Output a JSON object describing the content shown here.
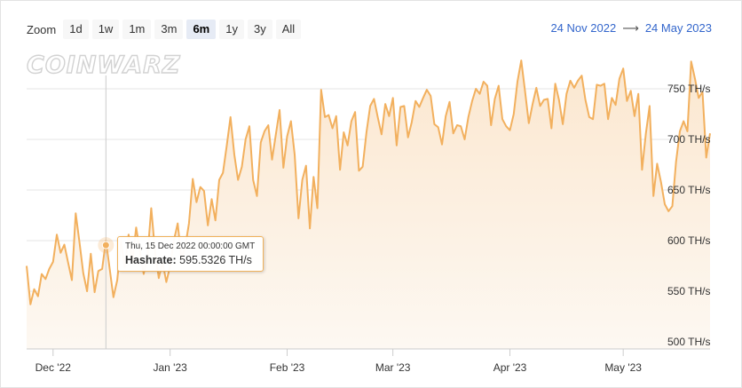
{
  "toolbar": {
    "zoom_label": "Zoom",
    "zoom_buttons": [
      "1d",
      "1w",
      "1m",
      "3m",
      "6m",
      "1y",
      "3y",
      "All"
    ],
    "active": "6m"
  },
  "range": {
    "from": "24 Nov 2022",
    "arrow": "⟶",
    "to": "24 May 2023"
  },
  "watermark": "CoinWarz",
  "tooltip": {
    "date": "Thu, 15 Dec 2022 00:00:00 GMT",
    "label": "Hashrate:",
    "value": "595.5326 TH/s"
  },
  "chart_data": {
    "type": "area",
    "ylim": [
      500,
      770
    ],
    "y_ticks": [
      500,
      550,
      600,
      650,
      700,
      750
    ],
    "y_tick_labels": [
      "500 TH/s",
      "550 TH/s",
      "600 TH/s",
      "650 TH/s",
      "700 TH/s",
      "750 TH/s"
    ],
    "x_start": "2022-11-24",
    "x_end": "2023-05-24",
    "x_ticks": [
      "2022-12-01",
      "2023-01-01",
      "2023-02-01",
      "2023-03-01",
      "2023-04-01",
      "2023-05-01"
    ],
    "x_tick_labels": [
      "Dec '22",
      "Jan '23",
      "Feb '23",
      "Mar '23",
      "Apr '23",
      "May '23"
    ],
    "highlight": {
      "x": "2022-12-15",
      "y": 595.5
    },
    "colors": {
      "line": "#f2b05e",
      "fill_top": "#fbe7cf",
      "fill_bottom": "#fdf8f2",
      "grid": "#e6e6e6"
    },
    "series": [
      {
        "values": [
          575,
          537,
          552,
          545,
          567,
          562,
          572,
          579,
          606,
          588,
          596,
          578,
          561,
          627,
          598,
          568,
          550,
          587,
          549,
          570,
          572,
          600,
          572,
          544,
          561,
          600,
          573,
          606,
          579,
          613,
          590,
          567,
          584,
          632,
          590,
          563,
          579,
          559,
          575,
          600,
          617,
          582,
          594,
          617,
          661,
          638,
          653,
          649,
          615,
          641,
          620,
          660,
          667,
          694,
          722,
          685,
          660,
          673,
          700,
          713,
          660,
          644,
          697,
          708,
          714,
          680,
          705,
          729,
          672,
          703,
          718,
          685,
          622,
          660,
          674,
          612,
          663,
          632,
          749,
          722,
          724,
          711,
          723,
          670,
          707,
          694,
          718,
          727,
          669,
          673,
          707,
          733,
          740,
          722,
          705,
          735,
          723,
          741,
          694,
          732,
          733,
          702,
          717,
          738,
          732,
          741,
          749,
          743,
          715,
          712,
          695,
          723,
          737,
          706,
          714,
          713,
          700,
          722,
          738,
          750,
          745,
          757,
          753,
          714,
          740,
          753,
          720,
          713,
          709,
          725,
          757,
          778,
          748,
          716,
          735,
          751,
          733,
          739,
          740,
          711,
          755,
          739,
          715,
          745,
          758,
          751,
          758,
          763,
          739,
          722,
          720,
          754,
          753,
          755,
          720,
          741,
          734,
          760,
          770,
          738,
          748,
          723,
          745,
          670,
          706,
          733,
          644,
          676,
          658,
          636,
          629,
          634,
          678,
          708,
          718,
          708,
          777,
          760,
          741,
          747,
          682,
          706
        ]
      }
    ]
  }
}
